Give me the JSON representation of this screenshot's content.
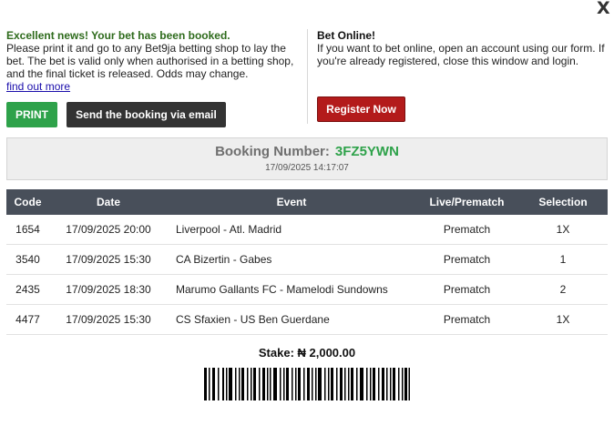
{
  "close_label": "X",
  "left_panel": {
    "headline": "Excellent news! Your bet has been booked.",
    "lines": [
      "Please print it and go to any Bet9ja betting shop to lay the",
      "bet. The bet is valid only when authorised in a betting shop,",
      "and the final ticket is released. Odds may change."
    ],
    "link": "find out more"
  },
  "right_panel": {
    "title": "Bet Online!",
    "lines": [
      "If you want to bet online, open an account using our form. If",
      "you're already registered, close this window and login."
    ]
  },
  "buttons": {
    "print": "PRINT",
    "email": "Send the booking via email",
    "register": "Register Now"
  },
  "booking": {
    "label": "Booking Number:",
    "code": "3FZ5YWN",
    "datetime": "17/09/2025 14:17:07"
  },
  "table": {
    "headers": {
      "code": "Code",
      "date": "Date",
      "event": "Event",
      "live": "Live/Prematch",
      "selection": "Selection"
    },
    "rows": [
      {
        "code": "1654",
        "date": "17/09/2025 20:00",
        "event": "Liverpool - Atl. Madrid",
        "live": "Prematch",
        "selection": "1X"
      },
      {
        "code": "3540",
        "date": "17/09/2025 15:30",
        "event": "CA Bizertin - Gabes",
        "live": "Prematch",
        "selection": "1"
      },
      {
        "code": "2435",
        "date": "17/09/2025 18:30",
        "event": "Marumo Gallants FC - Mamelodi Sundowns",
        "live": "Prematch",
        "selection": "2"
      },
      {
        "code": "4477",
        "date": "17/09/2025 15:30",
        "event": "CS Sfaxien - US Ben Guerdane",
        "live": "Prematch",
        "selection": "1X"
      }
    ]
  },
  "stake": "Stake: ₦ 2,000.00",
  "colors": {
    "accent_green": "#2ea24a",
    "headline_green": "#2e6b1c",
    "register_red": "#b31b1b",
    "table_header": "#484f5a"
  }
}
